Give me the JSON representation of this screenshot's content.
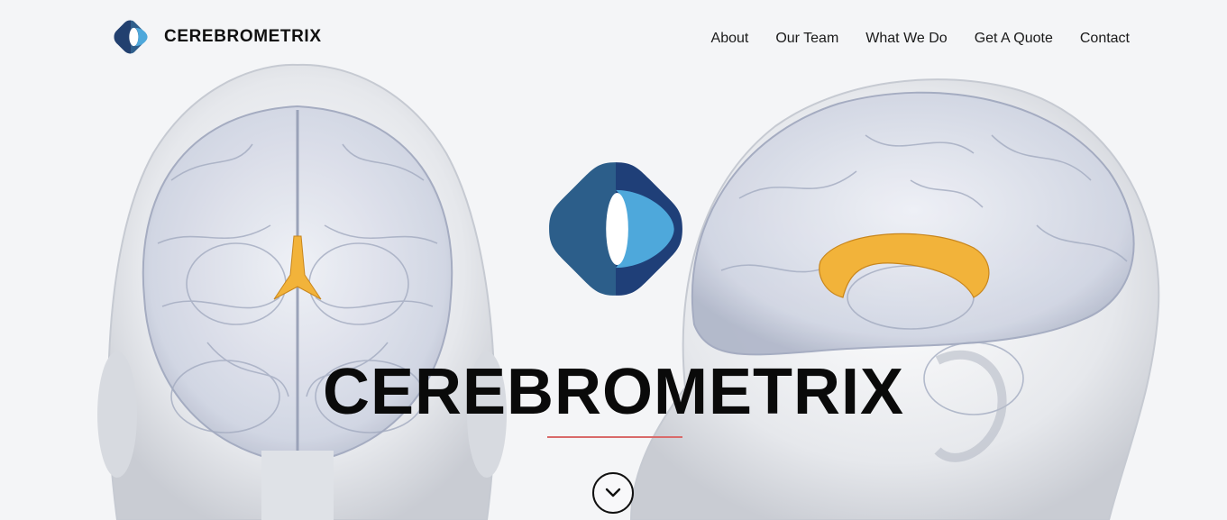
{
  "brand": {
    "name": "CEREBROMETRIX",
    "logo_icon": "cerebrometrix-diamond-logo"
  },
  "nav": {
    "items": [
      {
        "label": "About"
      },
      {
        "label": "Our Team"
      },
      {
        "label": "What We Do"
      },
      {
        "label": "Get A Quote"
      },
      {
        "label": "Contact"
      }
    ]
  },
  "hero": {
    "title": "CEREBROMETRIX",
    "background": "brain-scan-illustration",
    "scroll_icon": "chevron-down-icon"
  },
  "colors": {
    "logo_dark": "#1f3f78",
    "logo_mid": "#2f5f8c",
    "logo_light": "#4ea8db",
    "accent_line": "#d96a6a",
    "highlight_orange": "#f2b33a"
  }
}
